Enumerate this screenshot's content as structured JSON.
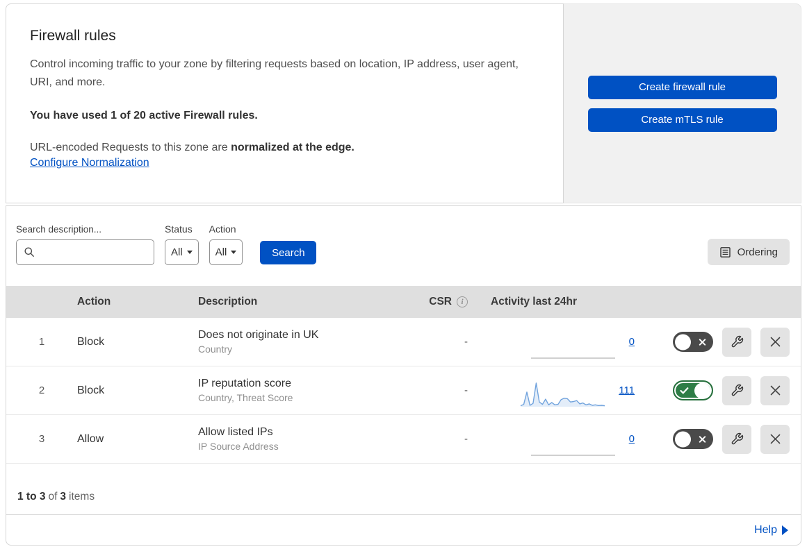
{
  "header": {
    "title": "Firewall rules",
    "description": "Control incoming traffic to your zone by filtering requests based on location, IP address, user agent, URI, and more.",
    "usage_text": "You have used 1 of 20 active Firewall rules.",
    "normalization_prefix": "URL-encoded Requests to this zone are ",
    "normalization_bold": "normalized at the edge.",
    "configure_link": "Configure Normalization"
  },
  "actions_panel": {
    "create_firewall_label": "Create firewall rule",
    "create_mtls_label": "Create mTLS rule"
  },
  "filters": {
    "search_label": "Search description...",
    "search_value": "",
    "status_label": "Status",
    "status_value": "All",
    "action_label": "Action",
    "action_value": "All",
    "search_button_label": "Search",
    "ordering_button_label": "Ordering"
  },
  "table": {
    "columns": {
      "action": "Action",
      "description": "Description",
      "csr": "CSR",
      "activity": "Activity last 24hr"
    },
    "rows": [
      {
        "priority": "1",
        "action": "Block",
        "description": "Does not originate in UK",
        "fields": "Country",
        "csr": "-",
        "activity_count": "0",
        "enabled": false,
        "sparkline": []
      },
      {
        "priority": "2",
        "action": "Block",
        "description": "IP reputation score",
        "fields": "Country, Threat Score",
        "csr": "-",
        "activity_count": "111",
        "enabled": true,
        "sparkline": [
          4,
          10,
          62,
          6,
          14,
          100,
          20,
          10,
          32,
          8,
          18,
          8,
          10,
          30,
          36,
          34,
          20,
          22,
          26,
          12,
          16,
          8,
          12,
          6,
          8,
          5,
          6,
          4
        ]
      },
      {
        "priority": "3",
        "action": "Allow",
        "description": "Allow listed IPs",
        "fields": "IP Source Address",
        "csr": "-",
        "activity_count": "0",
        "enabled": false,
        "sparkline": []
      }
    ],
    "footer_range": "1 to 3",
    "footer_of": "of",
    "footer_total": "3",
    "footer_items": "items"
  },
  "help": {
    "label": "Help"
  },
  "colors": {
    "accent_blue": "#0051c3",
    "toggle_on_green": "#2e7d46",
    "toggle_off_gray": "#4a4a4a",
    "sparkline_stroke": "#71a3dd",
    "sparkline_fill": "#e3edf9",
    "empty_line_gray": "#b4b4b4",
    "table_header_bg": "#dfdfdf"
  }
}
